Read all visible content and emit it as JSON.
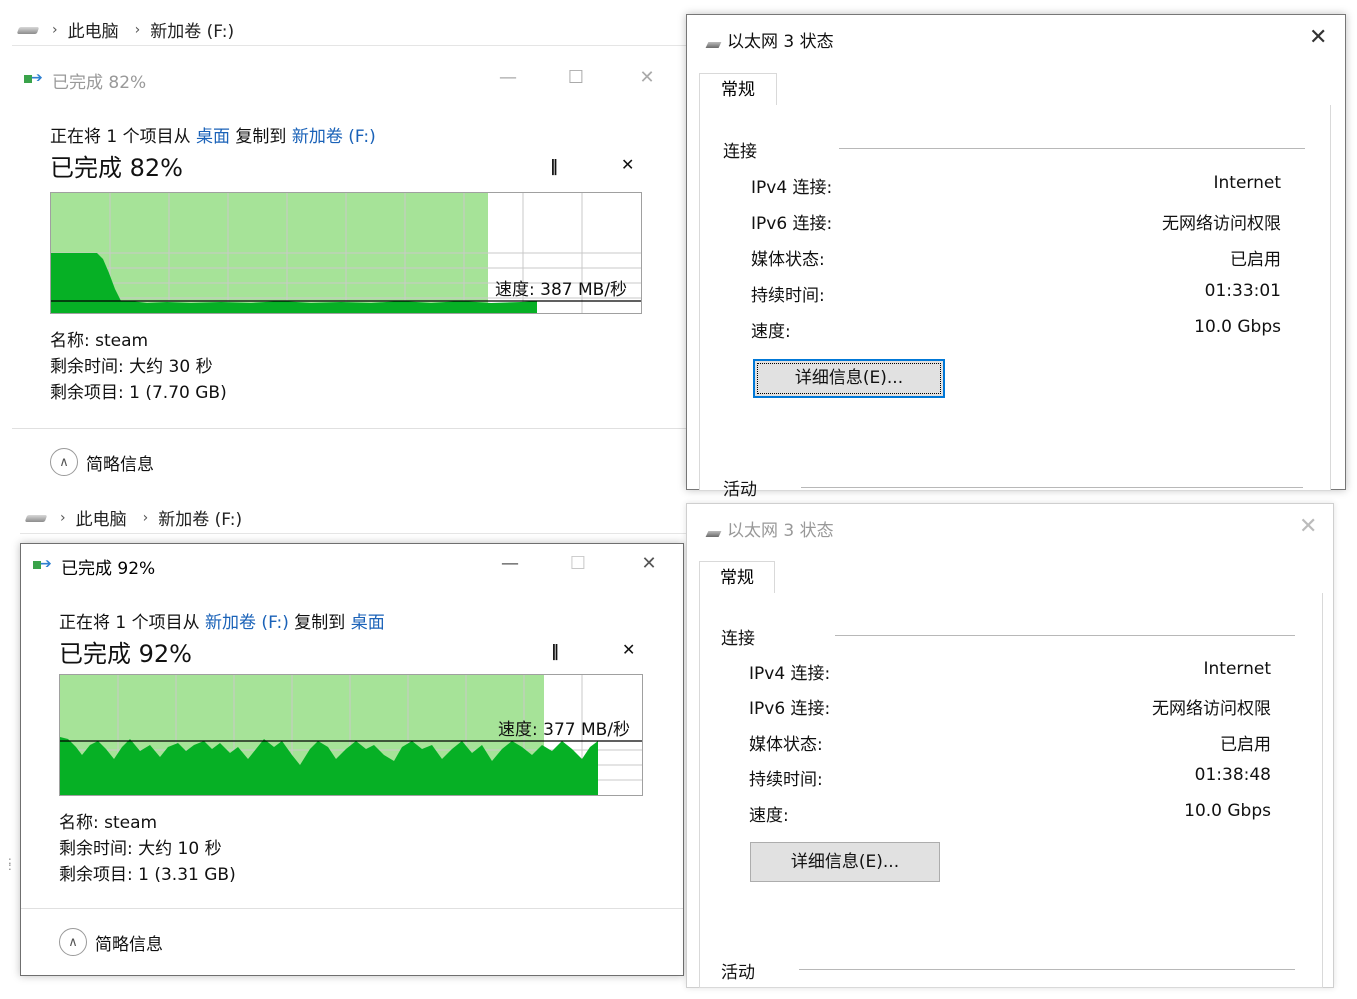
{
  "top": {
    "explorer": {
      "crumbs": [
        "此电脑",
        "新加卷 (F:)"
      ]
    },
    "copy_dialog": {
      "title": "已完成 82%",
      "line_prefix": "正在将 1 个项目从 ",
      "from_link": "桌面",
      "line_middle": " 复制到 ",
      "to_link": "新加卷 (F:)",
      "big": "已完成 82%",
      "speed": "速度: 387 MB/秒",
      "name_row": "名称:  steam",
      "time_row": "剩余时间:  大约 30 秒",
      "items_row": "剩余项目:  1 (7.70 GB)",
      "less_info": "简略信息",
      "progress_percent": 82
    },
    "net_dialog": {
      "title": "以太网 3 状态",
      "tab": "常规",
      "group_conn": "连接",
      "rows": [
        {
          "k": "IPv4 连接:",
          "v": "Internet"
        },
        {
          "k": "IPv6 连接:",
          "v": "无网络访问权限"
        },
        {
          "k": "媒体状态:",
          "v": "已启用"
        },
        {
          "k": "持续时间:",
          "v": "01:33:01"
        },
        {
          "k": "速度:",
          "v": "10.0 Gbps"
        }
      ],
      "details_btn": "详细信息(E)...",
      "group_activity": "活动"
    }
  },
  "bottom": {
    "explorer": {
      "crumbs": [
        "此电脑",
        "新加卷 (F:)"
      ]
    },
    "copy_dialog": {
      "title": "已完成 92%",
      "line_prefix": "正在将 1 个项目从 ",
      "from_link": "新加卷 (F:)",
      "line_middle": " 复制到 ",
      "to_link": "桌面",
      "big": "已完成 92%",
      "speed": "速度: 377 MB/秒",
      "name_row": "名称:  steam",
      "time_row": "剩余时间:  大约 10 秒",
      "items_row": "剩余项目:  1 (3.31 GB)",
      "less_info": "简略信息",
      "progress_percent": 92
    },
    "net_dialog": {
      "title": "以太网 3 状态",
      "tab": "常规",
      "group_conn": "连接",
      "rows": [
        {
          "k": "IPv4 连接:",
          "v": "Internet"
        },
        {
          "k": "IPv6 连接:",
          "v": "无网络访问权限"
        },
        {
          "k": "媒体状态:",
          "v": "已启用"
        },
        {
          "k": "持续时间:",
          "v": "01:38:48"
        },
        {
          "k": "速度:",
          "v": "10.0 Gbps"
        }
      ],
      "details_btn": "详细信息(E)...",
      "group_activity": "活动"
    }
  },
  "icons": {
    "drive": "drive-icon",
    "chevron": "chevron-right-icon",
    "copy": "copy-progress-icon",
    "network": "network-adapter-icon",
    "pause": "pause-icon",
    "stop": "stop-icon",
    "collapse": "chevron-up-icon"
  },
  "colors": {
    "graph_light": "#a6e398",
    "graph_dark": "#06b025",
    "link": "#1a62b8"
  }
}
